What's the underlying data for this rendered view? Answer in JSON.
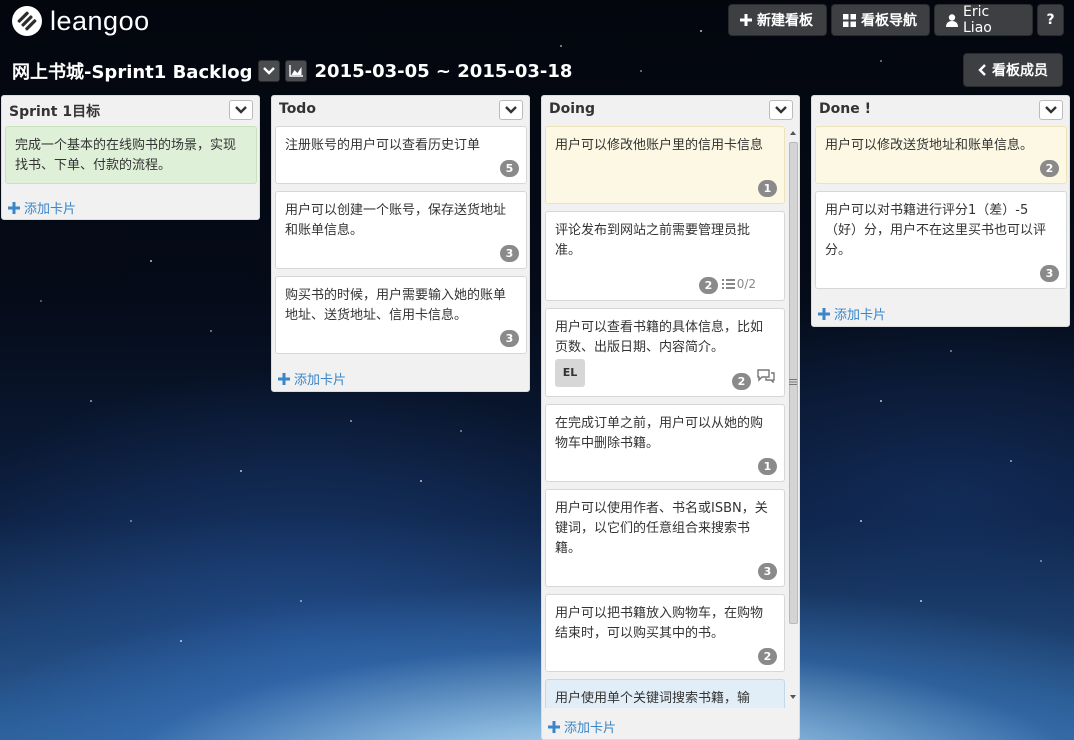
{
  "app": {
    "logo_text": "leangoo"
  },
  "topbar": {
    "new_board": "新建看板",
    "board_nav": "看板导航",
    "user": "Eric Liao",
    "help": "?"
  },
  "board": {
    "title": "网上书城-Sprint1 Backlog",
    "date_range": "2015-03-05 ~ 2015-03-18",
    "members_btn": "看板成员"
  },
  "add_card_label": "添加卡片",
  "lists": [
    {
      "title": "Sprint 1目标",
      "cards": [
        {
          "text": "完成一个基本的在线购书的场景，实现找书、下单、付款的流程。"
        }
      ]
    },
    {
      "title": "Todo",
      "cards": [
        {
          "text": "注册账号的用户可以查看历史订单",
          "badge": "5"
        },
        {
          "text": "用户可以创建一个账号，保存送货地址和账单信息。",
          "badge": "3"
        },
        {
          "text": "购买书的时候，用户需要输入她的账单地址、送货地址、信用卡信息。",
          "badge": "3"
        }
      ]
    },
    {
      "title": "Doing",
      "cards": [
        {
          "text": "用户可以修改他账户里的信用卡信息",
          "badge": "1"
        },
        {
          "text": "评论发布到网站之前需要管理员批准。",
          "badge": "2",
          "checklist": "0/2"
        },
        {
          "text": "用户可以查看书籍的具体信息，比如页数、出版日期、内容简介。",
          "badge": "2",
          "avatar": "EL"
        },
        {
          "text": "在完成订单之前，用户可以从她的购物车中删除书籍。",
          "badge": "1"
        },
        {
          "text": "用户可以使用作者、书名或ISBN，关键词，以它们的任意组合来搜索书籍。",
          "badge": "3"
        },
        {
          "text": "用户可以把书籍放入购物车，在购物结束时，可以购买其中的书。",
          "badge": "2"
        },
        {
          "text": "用户使用单个关键词搜索书籍，输"
        }
      ]
    },
    {
      "title": "Done !",
      "cards": [
        {
          "text": "用户可以修改送货地址和账单信息。",
          "badge": "2"
        },
        {
          "text": "用户可以对书籍进行评分1（差）-5（好）分，用户不在这里买书也可以评分。",
          "badge": "3"
        }
      ]
    }
  ],
  "colors": {
    "goal_card": "#dff0d8",
    "highlight_card": "#fcf8e3",
    "selected_card": "#e1eef7",
    "link": "#3a86c8",
    "badge": "#8a8a8a"
  }
}
